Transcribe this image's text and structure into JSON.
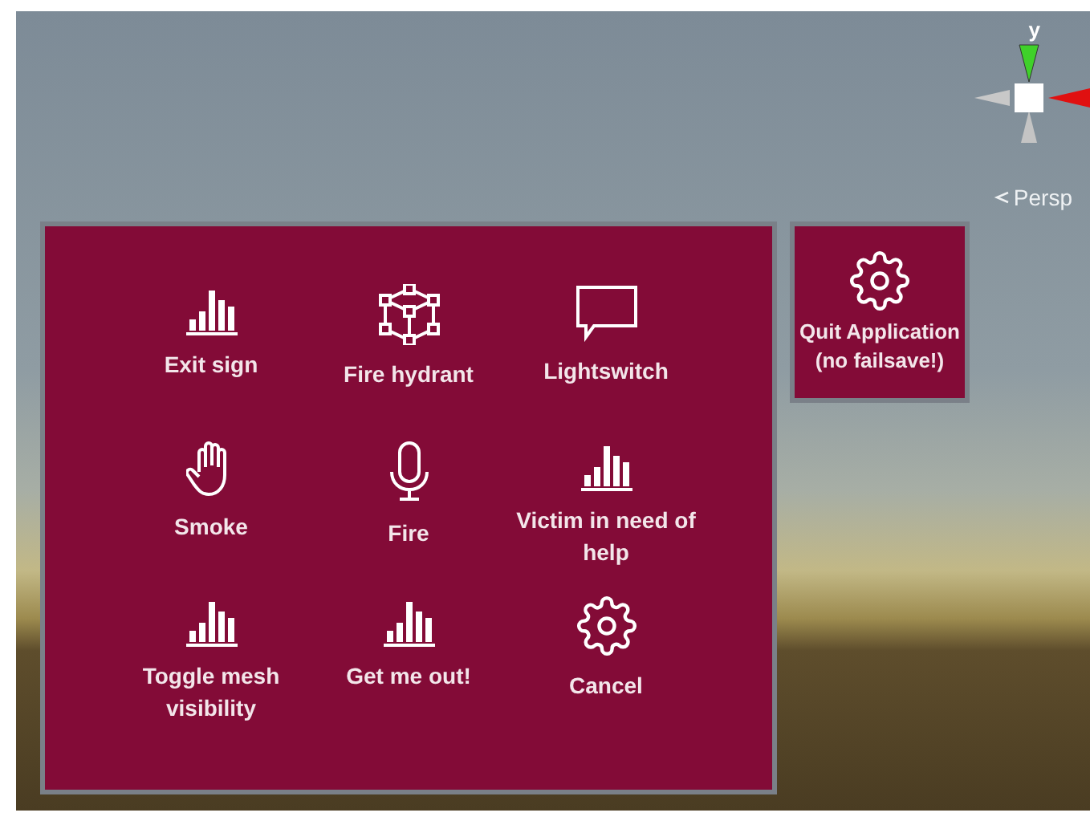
{
  "scene_view": {
    "gizmo_axis_label": "y",
    "projection_label": "Persp"
  },
  "menu": {
    "items": [
      {
        "kind": "bars",
        "lines": [
          "Exit sign"
        ]
      },
      {
        "kind": "network",
        "lines": [
          "Fire hydrant"
        ]
      },
      {
        "kind": "speech",
        "lines": [
          "Lightswitch"
        ]
      },
      {
        "kind": "hand",
        "lines": [
          "Smoke"
        ]
      },
      {
        "kind": "mic",
        "lines": [
          "Fire"
        ]
      },
      {
        "kind": "bars",
        "lines": [
          "Victim in need of",
          "help"
        ]
      },
      {
        "kind": "bars",
        "lines": [
          "Toggle mesh",
          "visibility"
        ]
      },
      {
        "kind": "bars",
        "lines": [
          "Get me out!"
        ]
      },
      {
        "kind": "gear",
        "lines": [
          "Cancel"
        ]
      }
    ]
  },
  "quit_button": {
    "kind": "gear",
    "lines": [
      "Quit Application",
      "(no failsave!)"
    ]
  }
}
